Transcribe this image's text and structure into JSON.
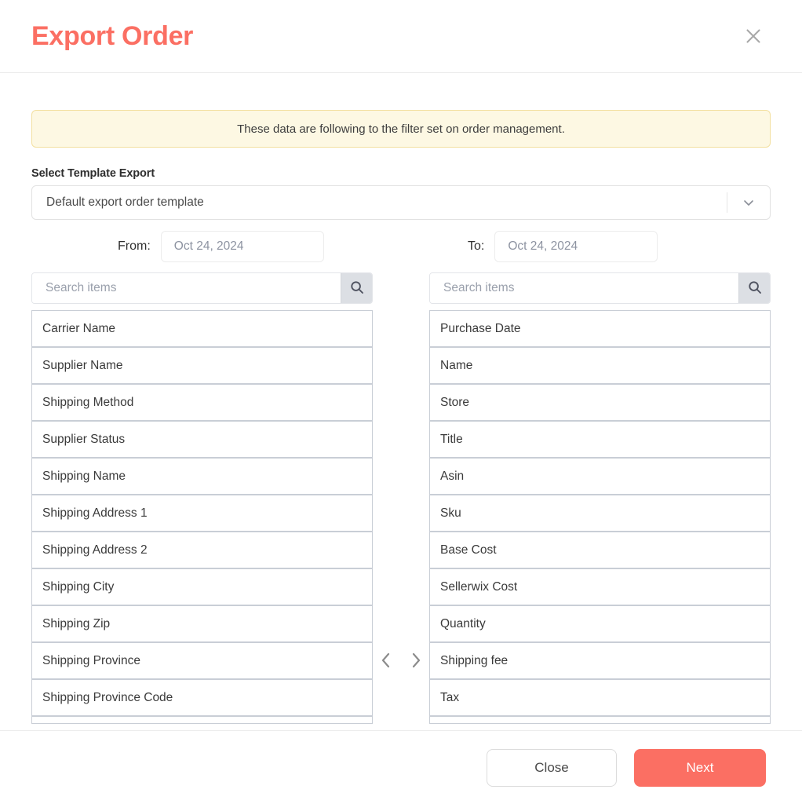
{
  "header": {
    "title": "Export Order",
    "close_icon": "close-icon",
    "accent_color": "#fb6f63"
  },
  "notice": {
    "text": "These data are following to the filter set on order management.",
    "background_color": "#fdf8e3",
    "border_color": "#f3e0a0"
  },
  "template": {
    "label": "Select Template Export",
    "selected": "Default export order template",
    "chevron_icon": "chevron-down-icon"
  },
  "dates": {
    "from_label": "From:",
    "from_value": "Oct 24, 2024",
    "to_label": "To:",
    "to_value": "Oct 24, 2024"
  },
  "search": {
    "left_placeholder": "Search items",
    "left_value": "",
    "right_placeholder": "Search items",
    "right_value": "",
    "icon": "search-icon"
  },
  "transfer": {
    "move_left_icon": "chevron-left-icon",
    "move_right_icon": "chevron-right-icon",
    "available_items": [
      "Carrier Name",
      "Supplier Name",
      "Shipping Method",
      "Supplier Status",
      "Shipping Name",
      "Shipping Address 1",
      "Shipping Address 2",
      "Shipping City",
      "Shipping Zip",
      "Shipping Province",
      "Shipping Province Code",
      ""
    ],
    "selected_items": [
      "Purchase Date",
      "Name",
      "Store",
      "Title",
      "Asin",
      "Sku",
      "Base Cost",
      "Sellerwix Cost",
      "Quantity",
      "Shipping fee",
      "Tax",
      ""
    ]
  },
  "footer": {
    "close_label": "Close",
    "next_label": "Next",
    "next_color": "#fb6f63"
  }
}
